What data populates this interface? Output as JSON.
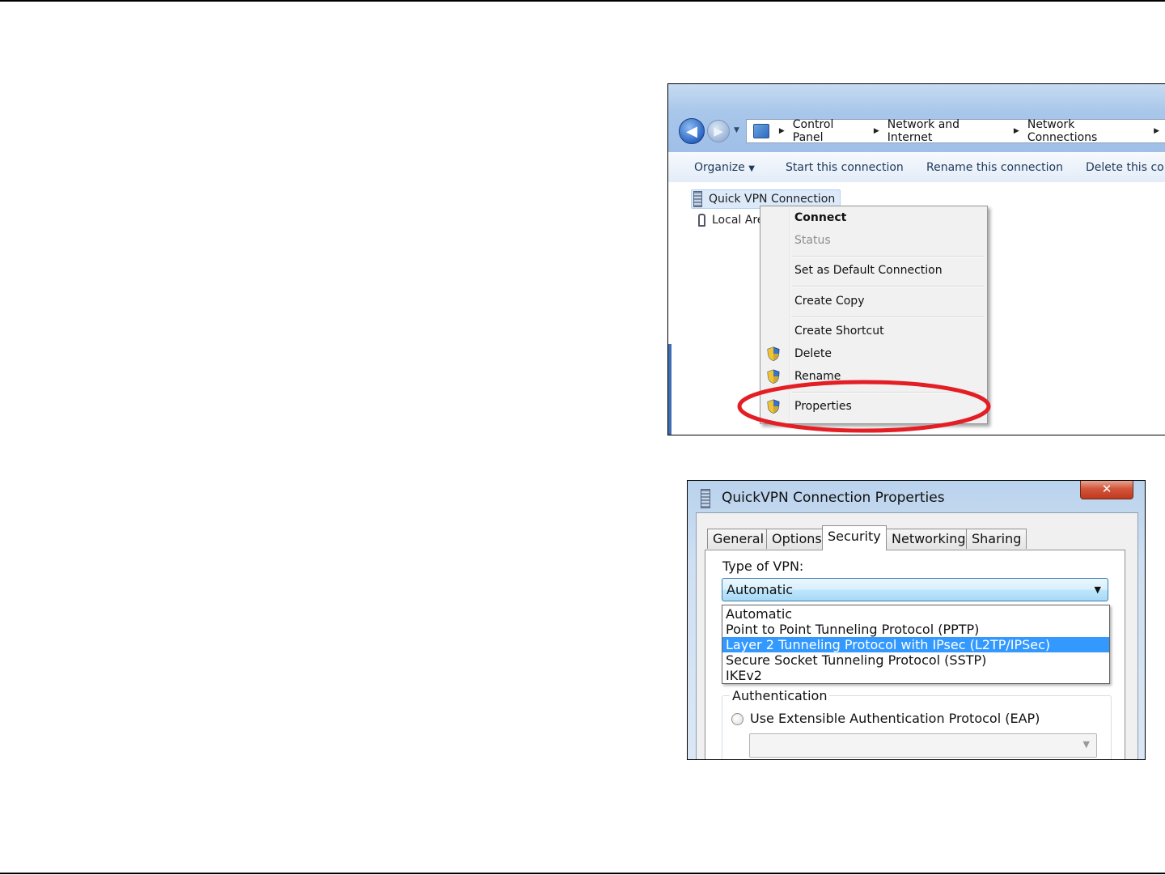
{
  "explorer": {
    "breadcrumb": [
      "Control Panel",
      "Network and Internet",
      "Network Connections"
    ],
    "toolbar": {
      "organize": "Organize",
      "start": "Start this connection",
      "rename": "Rename this connection",
      "delete": "Delete this con"
    },
    "connections": [
      {
        "label": "Quick VPN Connection",
        "selected": true
      },
      {
        "label": "Local Are",
        "selected": false
      }
    ],
    "context_menu": {
      "connect": "Connect",
      "status": "Status",
      "set_default": "Set as Default Connection",
      "create_copy": "Create Copy",
      "create_shortcut": "Create Shortcut",
      "delete": "Delete",
      "rename": "Rename",
      "properties": "Properties"
    },
    "highlight_color": "#e31e24"
  },
  "dialog": {
    "title": "QuickVPN Connection Properties",
    "close_glyph": "✕",
    "tabs": [
      "General",
      "Options",
      "Security",
      "Networking",
      "Sharing"
    ],
    "active_tab": "Security",
    "type_label": "Type of VPN:",
    "selected_value": "Automatic",
    "options": [
      "Automatic",
      "Point to Point Tunneling Protocol (PPTP)",
      "Layer 2 Tunneling Protocol with IPsec (L2TP/IPSec)",
      "Secure Socket Tunneling Protocol (SSTP)",
      "IKEv2"
    ],
    "highlighted_option": "Layer 2 Tunneling Protocol with IPsec (L2TP/IPSec)",
    "auth_group": "Authentication",
    "eap_radio": "Use Extensible Authentication Protocol (EAP)",
    "eap_value": ""
  }
}
